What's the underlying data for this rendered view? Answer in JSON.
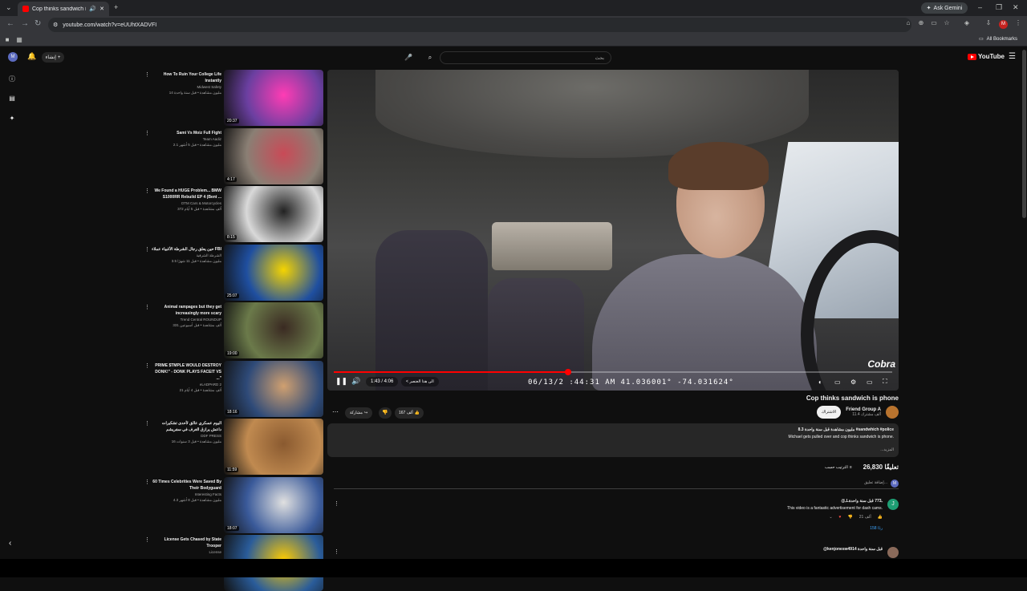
{
  "browser": {
    "tab_title": "Cop thinks sandwich is phone",
    "url": "youtube.com/watch?v=eUUhtXADVFI",
    "gemini_label": "Ask Gemini",
    "all_bookmarks": "All Bookmarks",
    "profile_initial": "M"
  },
  "topbar": {
    "logo_text": "YouTube",
    "search_placeholder": "بحث",
    "create_label": "إنشاء",
    "avatar_initial": "M"
  },
  "player": {
    "time": "1:43 / 4:06",
    "chapter": "< الى هذا العنصر",
    "osd_text": "06/13/2  :44:31 AM 41.036001°  -74.031624°",
    "watermark": "Cobra",
    "progress_fraction": 0.419
  },
  "video": {
    "title": "Cop thinks sandwich is phone",
    "channel": "Friend Group A",
    "subscribers": "11.4 ألف مشترك",
    "subscribe_label": "الاشتراك",
    "share_label": "مشاركة",
    "like_count": "167 ألف",
    "description_meta": "8.3 مليون مشاهدة قبل سنة واحدة  #sandwhich #police",
    "description_text": "Michael gets pulled over and cop thinks sandwich is phone.",
    "description_more": "...المزيد"
  },
  "comments": {
    "count": "26,830 تعليقًا",
    "sort_label": "الترتيب حسب",
    "add_placeholder": "إضافة تعليق...",
    "add_avatar": "M",
    "items": [
      {
        "user": "@ـLـ773 قبل سنة واحدة",
        "text": "This video is a fantastic advertisement for dash cams.",
        "likes": "21 ألف",
        "replies": "158 ردًا",
        "avatar_initial": "J"
      },
      {
        "user": "@kenjonesw4914 قبل سنة واحدة",
        "text": "",
        "likes": "",
        "replies": "",
        "avatar_initial": ""
      }
    ]
  },
  "recommendations": [
    {
      "title": "How To Ruin Your College Life Instantly",
      "channel": "Midwest Safety",
      "meta": "14 مليون مشاهدة • قبل سنة واحدة",
      "duration": "20:37"
    },
    {
      "title": "Sami Vs Moiz Full Fight",
      "channel": "Team Aadiz",
      "meta": "2.1 مليون مشاهدة • قبل 5 أشهر",
      "duration": "4:17"
    },
    {
      "title": "We Found a HUGE Problem... BMW S1000RR Rebuild EP 4 (Bent ...",
      "channel": "OTM Cars & Motorcycles",
      "meta": "372 ألف مشاهدة • قبل 5 أيام",
      "duration": "8:15"
    },
    {
      "title": "حين يعلق رجال الشرطة الأغبياء عملاء FBI",
      "channel": "الشرطة الشرقية",
      "meta": "3.5 مليون مشاهدة • قبل 11 شهرًا",
      "duration": "25:07"
    },
    {
      "title": "Animal rampages but they get increasingly more scary",
      "channel": "Trend Central ROUNDUP",
      "meta": "331 ألف مشاهدة • قبل أسبوعين",
      "duration": "19:00"
    },
    {
      "title": "PRIME $TMPLE WOULD DESTROY DONK!\" - DONK PLAYS FACEIT VS ...\"",
      "channel": "eLADPARD 2",
      "meta": "21 ألف مشاهدة • قبل 4 أيام",
      "duration": "18:16"
    },
    {
      "title": "اليوم عسكري عالق لأحدى تشكيرات داعش يرازق الغرف في سفريشم",
      "channel": "DDF PRESS",
      "meta": "16 مليون مشاهدة • قبل 3 سنوات",
      "duration": "11:59"
    },
    {
      "title": "60 Times Celebrities Were Saved By Their Bodyguard",
      "channel": "Interesting Facts",
      "meta": "4.3 مليون مشاهدة • قبل 8 أشهر",
      "duration": "18:07"
    },
    {
      "title": "License Gets Chased by State Trooper",
      "channel": "License",
      "meta": "",
      "duration": ""
    }
  ],
  "thumb_colors": [
    "#6a3fa0",
    "#8a7f74",
    "#d9d9d9",
    "#1f4fa0",
    "#6b7a4a",
    "#2e4a78",
    "#c08a50",
    "#3a5a9a",
    "#2a5c9a"
  ],
  "thumb_accents": [
    "#ff3cb4",
    "#c94a57",
    "#222222",
    "#f5d400",
    "#3a2a22",
    "#d0a070",
    "#8a5a30",
    "#e0e0e0",
    "#ffcc00"
  ]
}
